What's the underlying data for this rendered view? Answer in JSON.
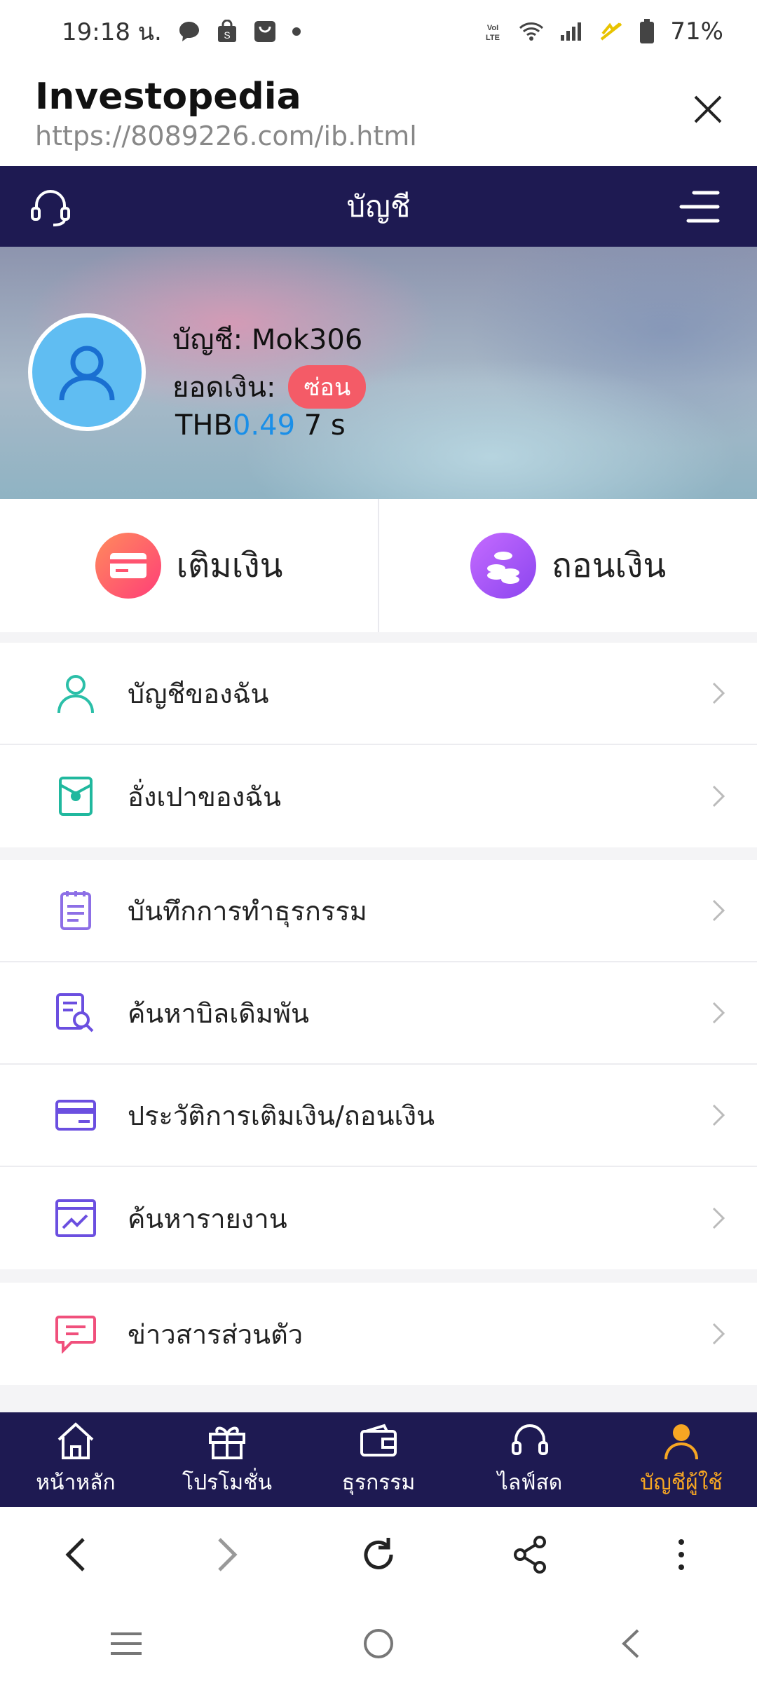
{
  "status_bar": {
    "time": "19:18 น.",
    "battery": "71%"
  },
  "tab": {
    "title": "Investopedia",
    "url": "https://8089226.com/ib.html"
  },
  "app_header": {
    "title": "บัญชี"
  },
  "account": {
    "account_label": "บัญชี:",
    "username": "Mok306",
    "balance_label": "ยอดเงิน:",
    "hide_badge": "ซ่อน",
    "currency": "THB",
    "balance": "0.49",
    "refresh_timer": "7 s"
  },
  "actions": {
    "deposit": "เติมเงิน",
    "withdraw": "ถอนเงิน"
  },
  "menu_groups": [
    [
      {
        "label": "บัญชีของฉัน",
        "icon": "user-icon"
      },
      {
        "label": "อั่งเปาของฉัน",
        "icon": "red-envelope-icon"
      }
    ],
    [
      {
        "label": "บันทึกการทำธุรกรรม",
        "icon": "clipboard-icon"
      },
      {
        "label": "ค้นหาบิลเดิมพัน",
        "icon": "bill-search-icon"
      },
      {
        "label": "ประวัติการเติมเงิน/ถอนเงิน",
        "icon": "card-icon"
      },
      {
        "label": "ค้นหารายงาน",
        "icon": "report-chart-icon"
      }
    ],
    [
      {
        "label": "ข่าวสารส่วนตัว",
        "icon": "message-icon"
      }
    ]
  ],
  "bottom_nav": [
    {
      "label": "หน้าหลัก",
      "icon": "home-icon",
      "active": false
    },
    {
      "label": "โปรโมชั่น",
      "icon": "gift-icon",
      "active": false
    },
    {
      "label": "ธุรกรรม",
      "icon": "wallet-icon",
      "active": false
    },
    {
      "label": "ไลฟ์สด",
      "icon": "headset-icon",
      "active": false
    },
    {
      "label": "บัญชีผู้ใช้",
      "icon": "user-icon",
      "active": true
    }
  ],
  "colors": {
    "header_bg": "#1e1a52",
    "active_nav": "#f6a623",
    "badge": "#f45b67",
    "balance_blue": "#1a8fe8"
  }
}
